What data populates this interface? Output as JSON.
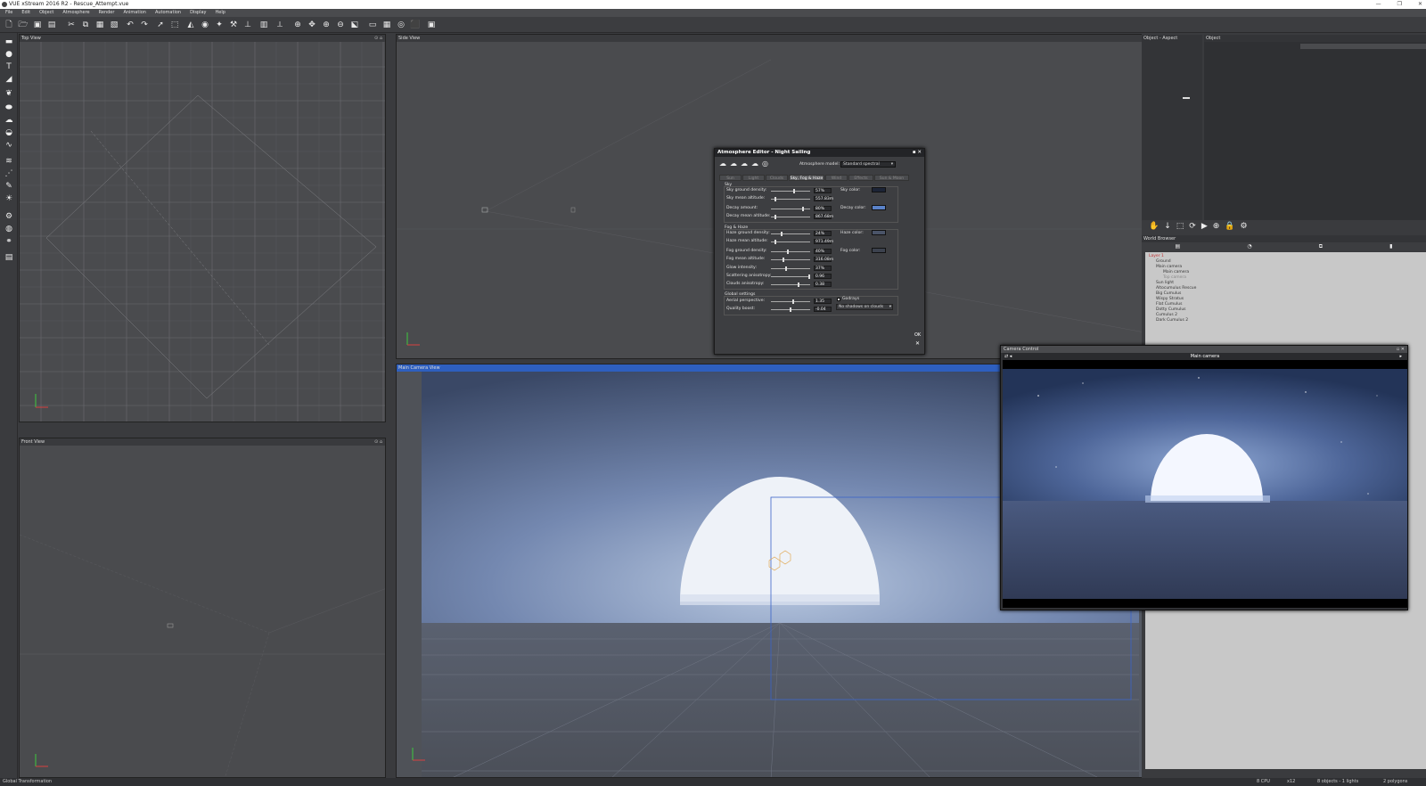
{
  "window": {
    "title": "VUE xStream 2016 R2 - Rescue_Attempt.vue"
  },
  "menu": [
    "File",
    "Edit",
    "Object",
    "Atmosphere",
    "Render",
    "Animation",
    "Automation",
    "Display",
    "Help"
  ],
  "views": {
    "top": {
      "title": "Top View"
    },
    "side": {
      "title": "Side View"
    },
    "front": {
      "title": "Front View"
    },
    "main": {
      "title": "Main Camera View"
    }
  },
  "right_panel": {
    "aspect_label": "Object - Aspect",
    "object_label": "Object",
    "world_browser_label": "World Browser",
    "tree": [
      "Layer 1",
      "Ground",
      "Main camera",
      "Main camera",
      "Top camera",
      "Sun light",
      "Altocumulus Rescue",
      "Big Cumulus",
      "Wispy Stratus",
      "Flat Cumulus",
      "Dotty Cumulus",
      "Cumulus 2",
      "Dark Cumulus 2"
    ]
  },
  "atmosphere_editor": {
    "title": "Atmosphere Editor - Night Sailing",
    "model_label": "Atmosphere model:",
    "model_value": "Standard spectral",
    "tabs": [
      "Sun",
      "Light",
      "Clouds",
      "Sky, Fog & Haze",
      "Wind",
      "Effects",
      "Sun & Moon"
    ],
    "active_tab": "Sky, Fog & Haze",
    "sky_section": "Sky",
    "fog_section": "Fog & Haze",
    "global_section": "Global settings",
    "rows": [
      {
        "label": "Sky ground density:",
        "value": "57%",
        "level": 0.57
      },
      {
        "label": "Sky mean altitude:",
        "value": "557.83m",
        "level": 0.08
      },
      {
        "label": "Decay amount:",
        "value": "80%",
        "level": 0.8
      },
      {
        "label": "Decay mean altitude:",
        "value": "867.68m",
        "level": 0.1
      },
      {
        "label": "Haze ground density:",
        "value": "24%",
        "level": 0.24
      },
      {
        "label": "Haze mean altitude:",
        "value": "971.49m",
        "level": 0.1
      },
      {
        "label": "Fog ground density:",
        "value": "40%",
        "level": 0.4
      },
      {
        "label": "Fog mean altitude:",
        "value": "316.08m",
        "level": 0.3
      },
      {
        "label": "Glow intensity:",
        "value": "37%",
        "level": 0.37
      },
      {
        "label": "Scattering anisotropy:",
        "value": "0.96",
        "level": 0.96
      },
      {
        "label": "Clouds anisotropy:",
        "value": "0.38",
        "level": 0.69
      }
    ],
    "global_rows": [
      {
        "label": "Aerial perspective:",
        "value": "1.35",
        "level": 0.55
      },
      {
        "label": "Quality boost:",
        "value": "-0.04",
        "level": 0.48
      }
    ],
    "sky_color_label": "Sky color:",
    "decay_color_label": "Decay color:",
    "haze_color_label": "Haze color:",
    "fog_color_label": "Fog color:",
    "godrays_label": "Godrays",
    "shadows_value": "No shadows on clouds",
    "ok_label": "OK",
    "colors": {
      "sky": "#1c2436",
      "decay": "#5a82c8",
      "haze": "#4a5468",
      "fog": "#3c424e"
    }
  },
  "camera_control": {
    "title": "Camera Control",
    "camera_name": "Main camera"
  },
  "status": {
    "left": "Global Transformation",
    "cpu": "8 CPU",
    "zoom": "x12",
    "objects": "8 objects - 1 lights",
    "polygons": "2 polygons"
  }
}
